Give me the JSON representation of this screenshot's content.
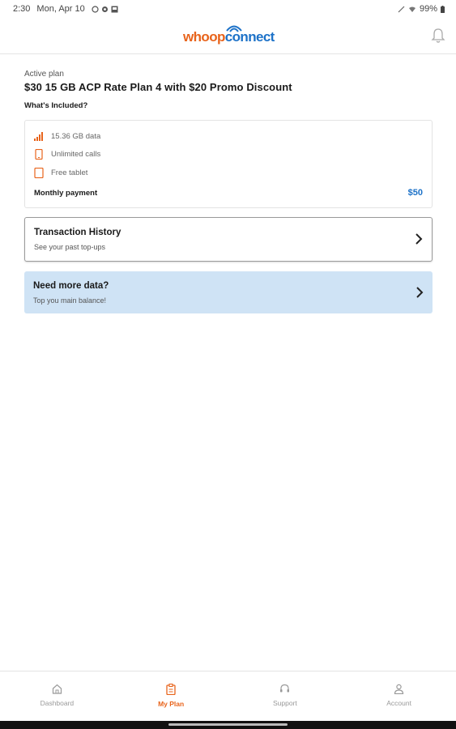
{
  "status_bar": {
    "time": "2:30",
    "date": "Mon, Apr 10",
    "battery": "99%"
  },
  "header": {
    "logo_part1": "whoop",
    "logo_part2": "connect"
  },
  "plan": {
    "label": "Active plan",
    "name": "$30 15 GB ACP Rate Plan 4 with $20 Promo Discount",
    "included_title": "What's Included?",
    "features": [
      {
        "icon": "signal-bars-icon",
        "label": "15.36 GB data"
      },
      {
        "icon": "phone-icon",
        "label": "Unlimited calls"
      },
      {
        "icon": "tablet-icon",
        "label": "Free tablet"
      }
    ],
    "payment_label": "Monthly payment",
    "payment_value": "$50"
  },
  "cards": {
    "history": {
      "title": "Transaction History",
      "subtitle": "See your past top-ups"
    },
    "data": {
      "title": "Need more data?",
      "subtitle": "Top you main balance!"
    }
  },
  "bottom_nav": [
    {
      "icon": "home-icon",
      "label": "Dashboard"
    },
    {
      "icon": "clipboard-icon",
      "label": "My Plan"
    },
    {
      "icon": "headset-icon",
      "label": "Support"
    },
    {
      "icon": "person-icon",
      "label": "Account"
    }
  ],
  "colors": {
    "brand_orange": "#e8641c",
    "brand_blue": "#1d72c8",
    "card_blue": "#cfe3f5"
  }
}
